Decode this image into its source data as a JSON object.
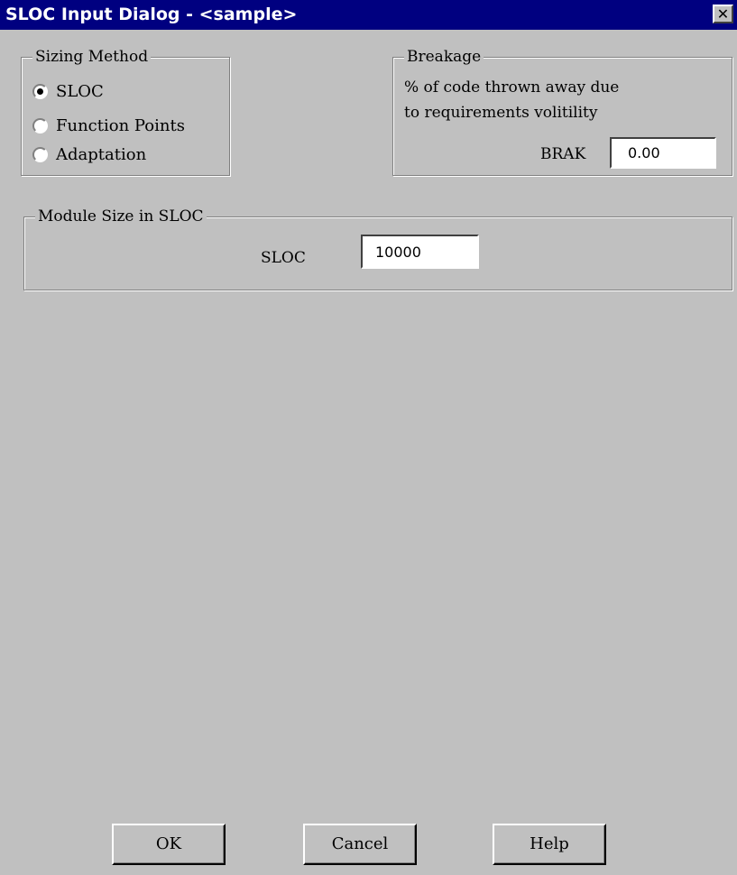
{
  "window": {
    "title": "SLOC Input Dialog - <sample>",
    "close_symbol": "✕"
  },
  "sizing_method": {
    "legend": "Sizing Method",
    "options": [
      {
        "label": "SLOC",
        "selected": true
      },
      {
        "label": "Function Points",
        "selected": false
      },
      {
        "label": "Adaptation",
        "selected": false
      }
    ]
  },
  "breakage": {
    "legend": "Breakage",
    "description_line1": "% of code thrown away due",
    "description_line2": "to requirements volitility",
    "field_label": "BRAK",
    "field_value": "0.00"
  },
  "module_size": {
    "legend": "Module Size in SLOC",
    "field_label": "SLOC",
    "field_value": "10000"
  },
  "buttons": {
    "ok": "OK",
    "cancel": "Cancel",
    "help": "Help"
  }
}
